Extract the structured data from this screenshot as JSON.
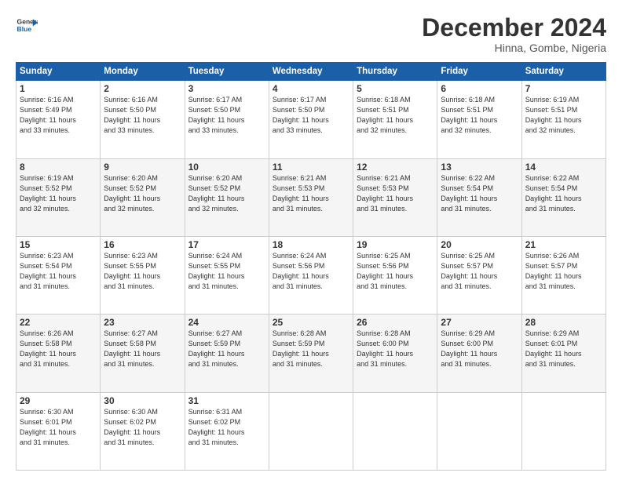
{
  "logo": {
    "line1": "General",
    "line2": "Blue"
  },
  "title": "December 2024",
  "location": "Hinna, Gombe, Nigeria",
  "weekdays": [
    "Sunday",
    "Monday",
    "Tuesday",
    "Wednesday",
    "Thursday",
    "Friday",
    "Saturday"
  ],
  "weeks": [
    [
      {
        "day": "1",
        "info": "Sunrise: 6:16 AM\nSunset: 5:49 PM\nDaylight: 11 hours\nand 33 minutes."
      },
      {
        "day": "2",
        "info": "Sunrise: 6:16 AM\nSunset: 5:50 PM\nDaylight: 11 hours\nand 33 minutes."
      },
      {
        "day": "3",
        "info": "Sunrise: 6:17 AM\nSunset: 5:50 PM\nDaylight: 11 hours\nand 33 minutes."
      },
      {
        "day": "4",
        "info": "Sunrise: 6:17 AM\nSunset: 5:50 PM\nDaylight: 11 hours\nand 33 minutes."
      },
      {
        "day": "5",
        "info": "Sunrise: 6:18 AM\nSunset: 5:51 PM\nDaylight: 11 hours\nand 32 minutes."
      },
      {
        "day": "6",
        "info": "Sunrise: 6:18 AM\nSunset: 5:51 PM\nDaylight: 11 hours\nand 32 minutes."
      },
      {
        "day": "7",
        "info": "Sunrise: 6:19 AM\nSunset: 5:51 PM\nDaylight: 11 hours\nand 32 minutes."
      }
    ],
    [
      {
        "day": "8",
        "info": "Sunrise: 6:19 AM\nSunset: 5:52 PM\nDaylight: 11 hours\nand 32 minutes."
      },
      {
        "day": "9",
        "info": "Sunrise: 6:20 AM\nSunset: 5:52 PM\nDaylight: 11 hours\nand 32 minutes."
      },
      {
        "day": "10",
        "info": "Sunrise: 6:20 AM\nSunset: 5:52 PM\nDaylight: 11 hours\nand 32 minutes."
      },
      {
        "day": "11",
        "info": "Sunrise: 6:21 AM\nSunset: 5:53 PM\nDaylight: 11 hours\nand 31 minutes."
      },
      {
        "day": "12",
        "info": "Sunrise: 6:21 AM\nSunset: 5:53 PM\nDaylight: 11 hours\nand 31 minutes."
      },
      {
        "day": "13",
        "info": "Sunrise: 6:22 AM\nSunset: 5:54 PM\nDaylight: 11 hours\nand 31 minutes."
      },
      {
        "day": "14",
        "info": "Sunrise: 6:22 AM\nSunset: 5:54 PM\nDaylight: 11 hours\nand 31 minutes."
      }
    ],
    [
      {
        "day": "15",
        "info": "Sunrise: 6:23 AM\nSunset: 5:54 PM\nDaylight: 11 hours\nand 31 minutes."
      },
      {
        "day": "16",
        "info": "Sunrise: 6:23 AM\nSunset: 5:55 PM\nDaylight: 11 hours\nand 31 minutes."
      },
      {
        "day": "17",
        "info": "Sunrise: 6:24 AM\nSunset: 5:55 PM\nDaylight: 11 hours\nand 31 minutes."
      },
      {
        "day": "18",
        "info": "Sunrise: 6:24 AM\nSunset: 5:56 PM\nDaylight: 11 hours\nand 31 minutes."
      },
      {
        "day": "19",
        "info": "Sunrise: 6:25 AM\nSunset: 5:56 PM\nDaylight: 11 hours\nand 31 minutes."
      },
      {
        "day": "20",
        "info": "Sunrise: 6:25 AM\nSunset: 5:57 PM\nDaylight: 11 hours\nand 31 minutes."
      },
      {
        "day": "21",
        "info": "Sunrise: 6:26 AM\nSunset: 5:57 PM\nDaylight: 11 hours\nand 31 minutes."
      }
    ],
    [
      {
        "day": "22",
        "info": "Sunrise: 6:26 AM\nSunset: 5:58 PM\nDaylight: 11 hours\nand 31 minutes."
      },
      {
        "day": "23",
        "info": "Sunrise: 6:27 AM\nSunset: 5:58 PM\nDaylight: 11 hours\nand 31 minutes."
      },
      {
        "day": "24",
        "info": "Sunrise: 6:27 AM\nSunset: 5:59 PM\nDaylight: 11 hours\nand 31 minutes."
      },
      {
        "day": "25",
        "info": "Sunrise: 6:28 AM\nSunset: 5:59 PM\nDaylight: 11 hours\nand 31 minutes."
      },
      {
        "day": "26",
        "info": "Sunrise: 6:28 AM\nSunset: 6:00 PM\nDaylight: 11 hours\nand 31 minutes."
      },
      {
        "day": "27",
        "info": "Sunrise: 6:29 AM\nSunset: 6:00 PM\nDaylight: 11 hours\nand 31 minutes."
      },
      {
        "day": "28",
        "info": "Sunrise: 6:29 AM\nSunset: 6:01 PM\nDaylight: 11 hours\nand 31 minutes."
      }
    ],
    [
      {
        "day": "29",
        "info": "Sunrise: 6:30 AM\nSunset: 6:01 PM\nDaylight: 11 hours\nand 31 minutes."
      },
      {
        "day": "30",
        "info": "Sunrise: 6:30 AM\nSunset: 6:02 PM\nDaylight: 11 hours\nand 31 minutes."
      },
      {
        "day": "31",
        "info": "Sunrise: 6:31 AM\nSunset: 6:02 PM\nDaylight: 11 hours\nand 31 minutes."
      },
      {
        "day": "",
        "info": ""
      },
      {
        "day": "",
        "info": ""
      },
      {
        "day": "",
        "info": ""
      },
      {
        "day": "",
        "info": ""
      }
    ]
  ]
}
